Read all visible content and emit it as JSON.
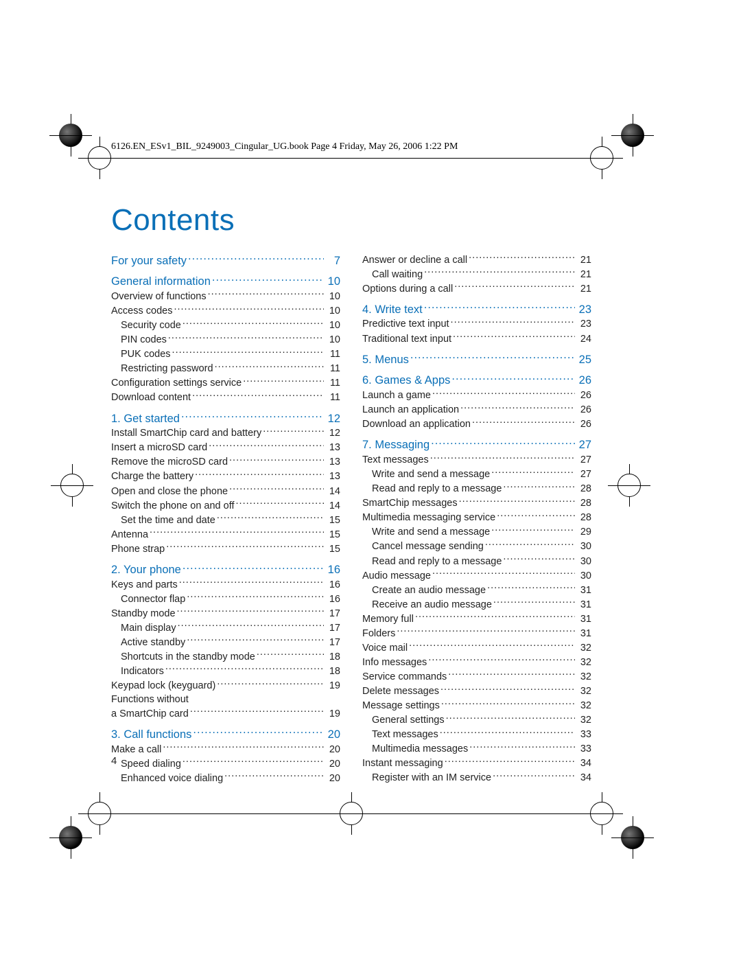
{
  "header_text": "6126.EN_ESv1_BIL_9249003_Cingular_UG.book  Page 4  Friday, May 26, 2006  1:22 PM",
  "contents_title": "Contents",
  "page_number": "4",
  "left_col": [
    {
      "type": "head",
      "label": "For your safety",
      "pg": "7",
      "first": true
    },
    {
      "type": "head",
      "label": "General information",
      "pg": "10"
    },
    {
      "type": "item",
      "label": "Overview of functions",
      "pg": "10"
    },
    {
      "type": "item",
      "label": "Access codes",
      "pg": "10"
    },
    {
      "type": "sub",
      "label": "Security code",
      "pg": "10"
    },
    {
      "type": "sub",
      "label": "PIN codes",
      "pg": "10"
    },
    {
      "type": "sub",
      "label": "PUK codes",
      "pg": "11"
    },
    {
      "type": "sub",
      "label": "Restricting password",
      "pg": "11"
    },
    {
      "type": "item",
      "label": "Configuration settings service",
      "pg": "11"
    },
    {
      "type": "item",
      "label": "Download content",
      "pg": "11"
    },
    {
      "type": "head",
      "label": "1.   Get started",
      "pg": "12"
    },
    {
      "type": "item",
      "label": "Install SmartChip card and battery",
      "pg": "12",
      "tight": true
    },
    {
      "type": "item",
      "label": "Insert a microSD card",
      "pg": "13"
    },
    {
      "type": "item",
      "label": "Remove the microSD card",
      "pg": "13"
    },
    {
      "type": "item",
      "label": "Charge the battery",
      "pg": "13"
    },
    {
      "type": "item",
      "label": "Open and close the phone",
      "pg": "14"
    },
    {
      "type": "item",
      "label": "Switch the phone on and off",
      "pg": "14"
    },
    {
      "type": "sub",
      "label": "Set the time and date",
      "pg": "15"
    },
    {
      "type": "item",
      "label": "Antenna",
      "pg": "15"
    },
    {
      "type": "item",
      "label": "Phone strap",
      "pg": "15"
    },
    {
      "type": "head",
      "label": "2.   Your phone",
      "pg": "16"
    },
    {
      "type": "item",
      "label": "Keys and parts",
      "pg": "16"
    },
    {
      "type": "sub",
      "label": "Connector flap",
      "pg": "16"
    },
    {
      "type": "item",
      "label": "Standby mode",
      "pg": "17"
    },
    {
      "type": "sub",
      "label": "Main display",
      "pg": "17"
    },
    {
      "type": "sub",
      "label": "Active standby",
      "pg": "17"
    },
    {
      "type": "sub",
      "label": "Shortcuts in the standby mode",
      "pg": "18"
    },
    {
      "type": "sub",
      "label": "Indicators",
      "pg": "18"
    },
    {
      "type": "item",
      "label": "Keypad lock (keyguard)",
      "pg": "19"
    },
    {
      "type": "multi",
      "line1": "Functions without",
      "label": "a SmartChip card",
      "pg": "19"
    },
    {
      "type": "head",
      "label": "3.   Call functions",
      "pg": "20"
    },
    {
      "type": "item",
      "label": "Make a call",
      "pg": "20"
    },
    {
      "type": "sub",
      "label": "Speed dialing",
      "pg": "20"
    },
    {
      "type": "sub",
      "label": "Enhanced voice dialing",
      "pg": "20"
    }
  ],
  "right_col": [
    {
      "type": "item",
      "label": "Answer or decline a call",
      "pg": "21",
      "first": true
    },
    {
      "type": "sub",
      "label": "Call waiting",
      "pg": "21"
    },
    {
      "type": "item",
      "label": "Options during a call",
      "pg": "21"
    },
    {
      "type": "head",
      "label": "4.   Write text",
      "pg": "23"
    },
    {
      "type": "item",
      "label": "Predictive text input",
      "pg": "23"
    },
    {
      "type": "item",
      "label": "Traditional text input",
      "pg": "24"
    },
    {
      "type": "head",
      "label": "5.   Menus",
      "pg": "25"
    },
    {
      "type": "head",
      "label": "6.   Games & Apps",
      "pg": "26"
    },
    {
      "type": "item",
      "label": "Launch a game",
      "pg": "26"
    },
    {
      "type": "item",
      "label": "Launch an application",
      "pg": "26"
    },
    {
      "type": "item",
      "label": "Download an application",
      "pg": "26"
    },
    {
      "type": "head",
      "label": "7.   Messaging",
      "pg": "27"
    },
    {
      "type": "item",
      "label": "Text messages",
      "pg": "27"
    },
    {
      "type": "sub",
      "label": "Write and send a message",
      "pg": "27"
    },
    {
      "type": "sub",
      "label": "Read and reply to a message",
      "pg": "28"
    },
    {
      "type": "item",
      "label": "SmartChip messages",
      "pg": "28"
    },
    {
      "type": "item",
      "label": "Multimedia messaging service",
      "pg": "28"
    },
    {
      "type": "sub",
      "label": "Write and send a message",
      "pg": "29"
    },
    {
      "type": "sub",
      "label": "Cancel message sending",
      "pg": "30"
    },
    {
      "type": "sub",
      "label": "Read and reply to a message",
      "pg": "30"
    },
    {
      "type": "item",
      "label": "Audio message",
      "pg": "30"
    },
    {
      "type": "sub",
      "label": "Create an audio message",
      "pg": "31"
    },
    {
      "type": "sub",
      "label": "Receive an audio message",
      "pg": "31"
    },
    {
      "type": "item",
      "label": "Memory full",
      "pg": "31"
    },
    {
      "type": "item",
      "label": "Folders",
      "pg": "31"
    },
    {
      "type": "item",
      "label": "Voice mail",
      "pg": "32"
    },
    {
      "type": "item",
      "label": "Info messages",
      "pg": "32"
    },
    {
      "type": "item",
      "label": "Service commands",
      "pg": "32"
    },
    {
      "type": "item",
      "label": "Delete messages",
      "pg": "32"
    },
    {
      "type": "item",
      "label": "Message settings",
      "pg": "32"
    },
    {
      "type": "sub",
      "label": "General settings",
      "pg": "32"
    },
    {
      "type": "sub",
      "label": "Text messages",
      "pg": "33"
    },
    {
      "type": "sub",
      "label": "Multimedia messages",
      "pg": "33"
    },
    {
      "type": "item",
      "label": "Instant messaging",
      "pg": "34"
    },
    {
      "type": "sub",
      "label": "Register with an IM service",
      "pg": "34"
    }
  ]
}
